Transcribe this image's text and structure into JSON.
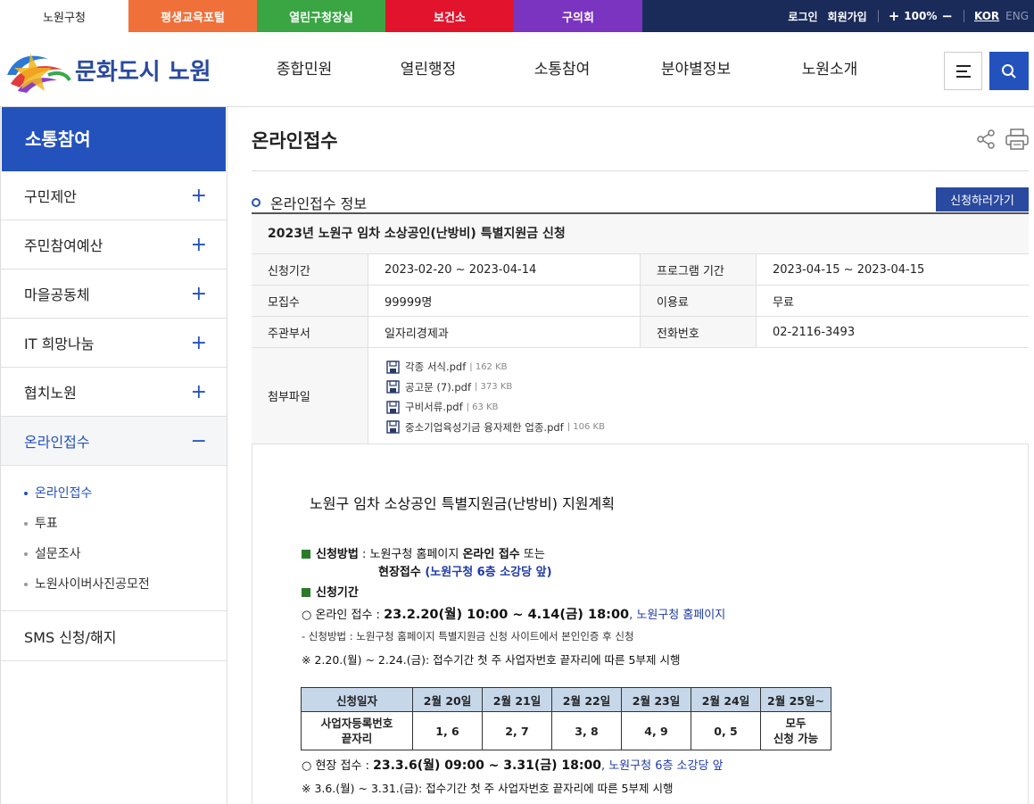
{
  "top_bar": {
    "tabs": [
      "노원구청",
      "평생교육포털",
      "열린구청장실",
      "보건소",
      "구의회"
    ],
    "login": "로그인",
    "join": "회원가입",
    "zoom_plus": "+",
    "zoom": "100%",
    "zoom_minus": "−",
    "lang_kor": "KOR",
    "lang_eng": "ENG"
  },
  "header": {
    "logo_alt": "문화도시 노원",
    "nav": [
      "종합민원",
      "열린행정",
      "소통참여",
      "분야별정보",
      "노원소개"
    ],
    "menu_icon": "hamburger-icon",
    "search_icon": "search-icon"
  },
  "sidebar": {
    "title": "소통참여",
    "items": [
      "구민제안",
      "주민참여예산",
      "마을공동체",
      "IT 희망나눔",
      "협치노원",
      "온라인접수"
    ],
    "expanded_symbol": "−",
    "collapsed_symbol": "+",
    "sub_items": [
      "온라인접수",
      "투표",
      "설문조사",
      "노원사이버사진공모전"
    ],
    "bottom_item": "SMS 신청/해지"
  },
  "page": {
    "title": "온라인접수",
    "section_title": "온라인접수 정보",
    "apply_button": "신청하러가기"
  },
  "info": {
    "caption": "2023년 노원구 임차 소상공인(난방비) 특별지원금 신청",
    "rows": [
      {
        "k1": "신청기간",
        "v1": "2023-02-20 ~ 2023-04-14",
        "k2": "프로그램 기간",
        "v2": "2023-04-15 ~ 2023-04-15"
      },
      {
        "k1": "모집수",
        "v1": "99999명",
        "k2": "이용료",
        "v2": "무료"
      },
      {
        "k1": "주관부서",
        "v1": "일자리경제과",
        "k2": "전화번호",
        "v2": "02-2116-3493"
      }
    ],
    "files_label": "첨부파일",
    "files": [
      {
        "name": "각종 서식.pdf",
        "size": "| 162 KB"
      },
      {
        "name": "공고문 (7).pdf",
        "size": "| 373 KB"
      },
      {
        "name": "구비서류.pdf",
        "size": "| 63 KB"
      },
      {
        "name": "중소기업육성기금 융자제한 업종.pdf",
        "size": "| 106 KB"
      }
    ]
  },
  "doc": {
    "title": "노원구 임차 소상공인  특별지원금(난방비) 지원계획",
    "method_label": "신청방법",
    "method_text": " : 노원구청 홈페이지 ",
    "method_online": "온라인 접수",
    "method_or": " 또는",
    "method_onsite": "현장접수",
    "method_place": " (노원구청 6층 소강당 앞)",
    "period_label": "신청기간",
    "online_prefix": "○ 온라인 접수 : ",
    "online_time": "23.2.20(월) 10:00 ~ 4.14(금) 18:00",
    "online_where": ", 노원구청 홈페이지",
    "online_note": "- 신청방법 : 노원구청 홈페이지 특별지원금 신청 사이트에서 본인인증 후 신청",
    "online_rule": "※ 2.20.(월) ~ 2.24.(금): 접수기간 첫 주 사업자번호 끝자리에 따른 5부제 시행",
    "table_headers": [
      "신청일자",
      "2월 20일",
      "2월 21일",
      "2월 22일",
      "2월 23일",
      "2월 24일",
      "2월 25일~"
    ],
    "table_row_label_1": "사업자등록번호",
    "table_row_label_2": "끝자리",
    "table_values": [
      "1, 6",
      "2, 7",
      "3, 8",
      "4, 9",
      "0, 5"
    ],
    "table_last_1": "모두",
    "table_last_2": "신청 가능",
    "onsite_prefix": "○ 현장 접수 : ",
    "onsite_time": "23.3.6(월) 09:00 ~ 3.31(금) 18:00",
    "onsite_where": ", 노원구청 6층 소강당 앞",
    "onsite_rule": "※ 3.6.(월) ~ 3.31.(금): 접수기간 첫 주 사업자번호 끝자리에 따른 5부제 시행"
  }
}
